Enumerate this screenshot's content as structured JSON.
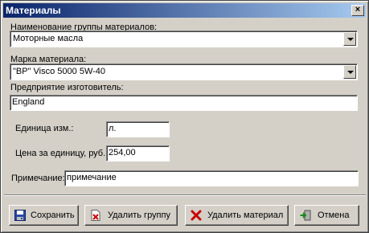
{
  "window": {
    "title": "Материалы",
    "close_glyph": "×"
  },
  "form": {
    "group_label": "Наименование группы материалов:",
    "group_value": "Моторные масла",
    "brand_label": "Марка материала:",
    "brand_value": "\"BP\" Visco 5000 5W-40",
    "manufacturer_label": "Предприятие изготовитель:",
    "manufacturer_value": "England",
    "unit_label": "Единица изм.:",
    "unit_value": "л.",
    "price_label": "Цена за единицу, руб.:",
    "price_value": "254,00",
    "note_label": "Примечание:",
    "note_value": "примечание"
  },
  "buttons": {
    "save": "Сохранить",
    "delete_group": "Удалить группу",
    "delete_material": "Удалить материал",
    "cancel": "Отмена"
  },
  "icons": {
    "save": "floppy-disk-icon",
    "delete_group": "document-delete-icon",
    "delete_material": "red-x-icon",
    "cancel": "exit-door-icon"
  },
  "colors": {
    "titlebar_start": "#0a246a",
    "titlebar_end": "#a6caf0",
    "face": "#d4d0c8"
  }
}
